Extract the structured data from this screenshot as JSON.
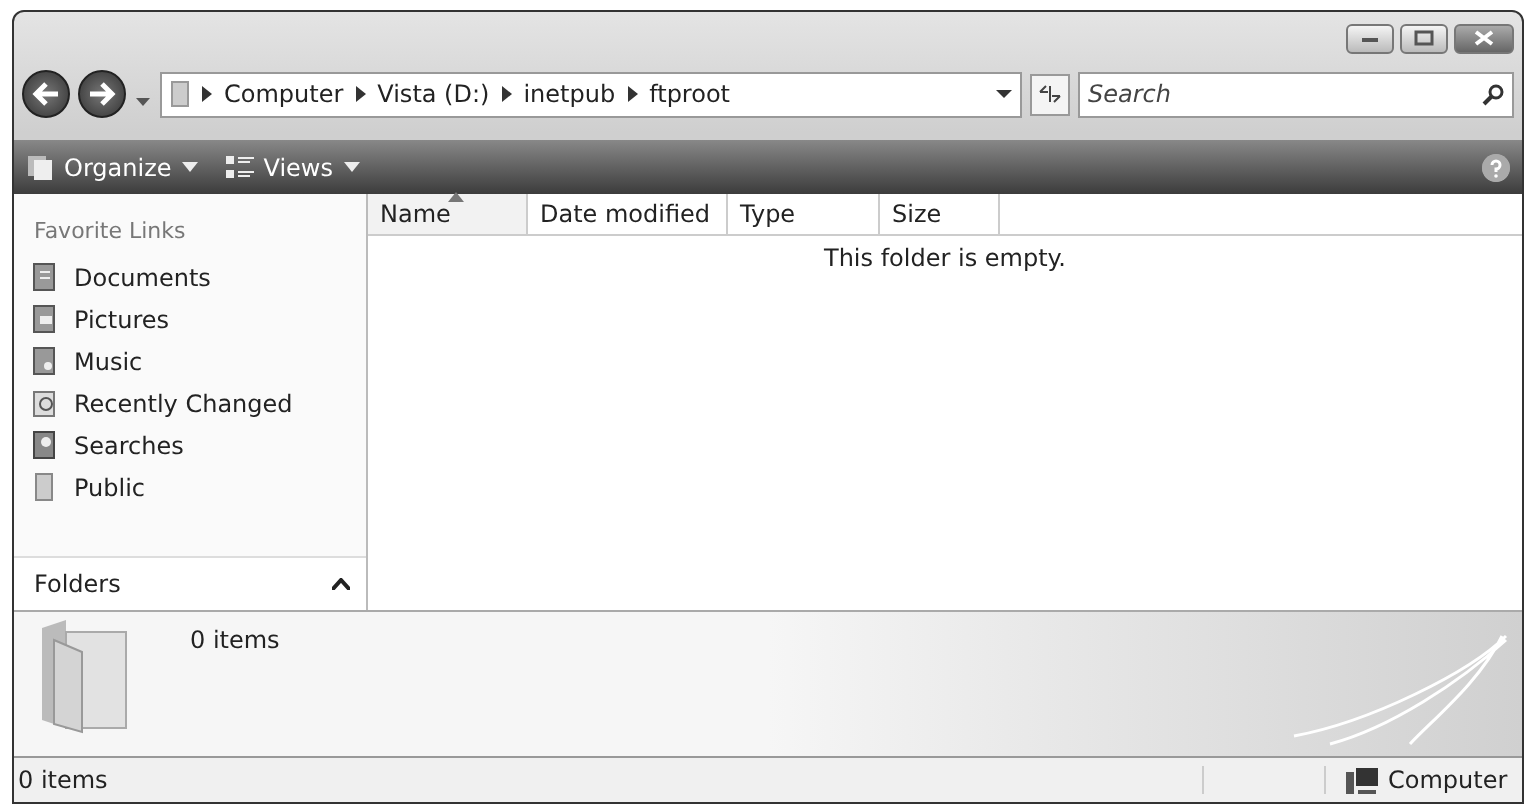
{
  "address_bar": {
    "breadcrumbs": [
      "Computer",
      "Vista (D:)",
      "inetpub",
      "ftproot"
    ]
  },
  "search": {
    "placeholder": "Search"
  },
  "toolbar": {
    "buttons": [
      {
        "label": "Organize",
        "kind": "organize"
      },
      {
        "label": "Views",
        "kind": "views"
      }
    ]
  },
  "sidebar": {
    "heading": "Favorite Links",
    "items": [
      {
        "label": "Documents",
        "kind": "documents"
      },
      {
        "label": "Pictures",
        "kind": "pictures"
      },
      {
        "label": "Music",
        "kind": "music"
      },
      {
        "label": "Recently Changed",
        "kind": "recent"
      },
      {
        "label": "Searches",
        "kind": "searches"
      },
      {
        "label": "Public",
        "kind": "public"
      }
    ],
    "folders_label": "Folders"
  },
  "table": {
    "columns": [
      {
        "label": "Name",
        "sorted": true
      },
      {
        "label": "Date modified",
        "sorted": false
      },
      {
        "label": "Type",
        "sorted": false
      },
      {
        "label": "Size",
        "sorted": false
      }
    ],
    "empty_message": "This folder is empty."
  },
  "details_pane": {
    "text": "0 items"
  },
  "status_bar": {
    "left": "0 items",
    "location": "Computer"
  }
}
